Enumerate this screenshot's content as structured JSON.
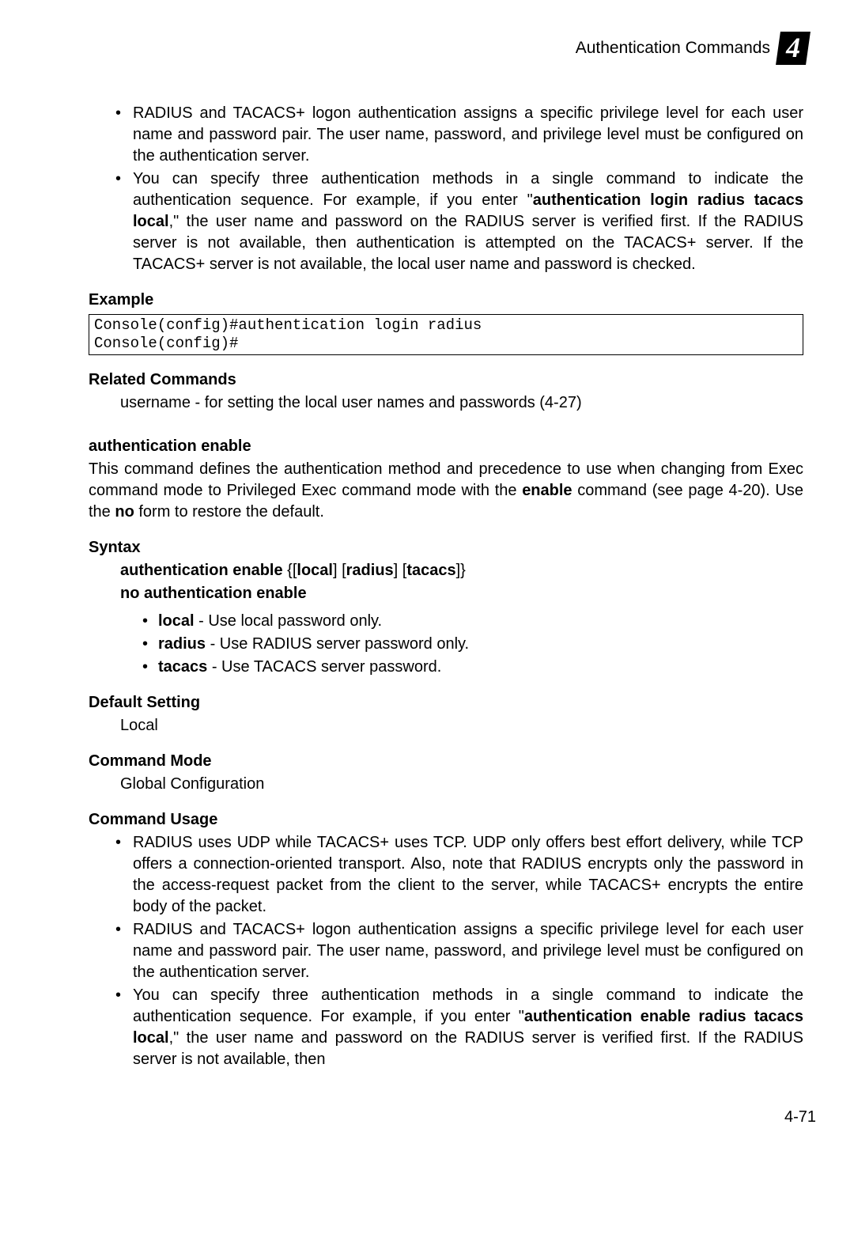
{
  "header": {
    "title": "Authentication Commands",
    "chapter": "4"
  },
  "top_bullets": {
    "b1": "RADIUS and TACACS+ logon authentication assigns a specific privilege level for each user name and password pair. The user name, password, and privilege level must be configured on the authentication server.",
    "b2_pre": "You can specify three authentication methods in a single command to indicate the authentication sequence. For example, if you enter \"",
    "b2_bold": "authentication login radius tacacs local",
    "b2_post": ",\" the user name and password on the RADIUS server is verified first. If the RADIUS server is not available, then authentication is attempted on the TACACS+ server. If the TACACS+ server is not available, the local user name and password is checked."
  },
  "example": {
    "heading": "Example",
    "code": "Console(config)#authentication login radius\nConsole(config)#"
  },
  "related": {
    "heading": "Related Commands",
    "line": "username - for setting the local user names and passwords (4-27)"
  },
  "auth_enable": {
    "heading": "authentication enable",
    "desc_pre": "This command defines the authentication method and precedence to use when changing from Exec command mode to Privileged Exec command mode with the ",
    "desc_b1": "enable",
    "desc_mid": " command (see page 4-20). Use the ",
    "desc_b2": "no",
    "desc_post": " form to restore the default."
  },
  "syntax": {
    "heading": "Syntax",
    "l1_b1": "authentication enable",
    "l1_t1": " {[",
    "l1_b2": "local",
    "l1_t2": "] [",
    "l1_b3": "radius",
    "l1_t3": "] [",
    "l1_b4": "tacacs",
    "l1_t4": "]}",
    "l2": "no authentication enable",
    "opt1_b": "local",
    "opt1_t": " - Use local password only.",
    "opt2_b": "radius",
    "opt2_t": " - Use RADIUS server password only.",
    "opt3_b": "tacacs",
    "opt3_t": " - Use TACACS server password."
  },
  "default_setting": {
    "heading": "Default Setting",
    "value": "Local"
  },
  "command_mode": {
    "heading": "Command Mode",
    "value": "Global Configuration"
  },
  "command_usage": {
    "heading": "Command Usage",
    "b1": "RADIUS uses UDP while TACACS+ uses TCP. UDP only offers best effort delivery, while TCP offers a connection-oriented transport. Also, note that RADIUS encrypts only the password in the access-request packet from the client to the server, while TACACS+ encrypts the entire body of the packet.",
    "b2": "RADIUS and TACACS+ logon authentication assigns a specific privilege level for each user name and password pair. The user name, password, and privilege level must be configured on the authentication server.",
    "b3_pre": "You can specify three authentication methods in a single command to indicate the authentication sequence. For example, if you enter \"",
    "b3_bold": "authentication enable radius tacacs local",
    "b3_post": ",\" the user name and password on the RADIUS server is verified first. If the RADIUS server is not available, then"
  },
  "page_num": "4-71"
}
